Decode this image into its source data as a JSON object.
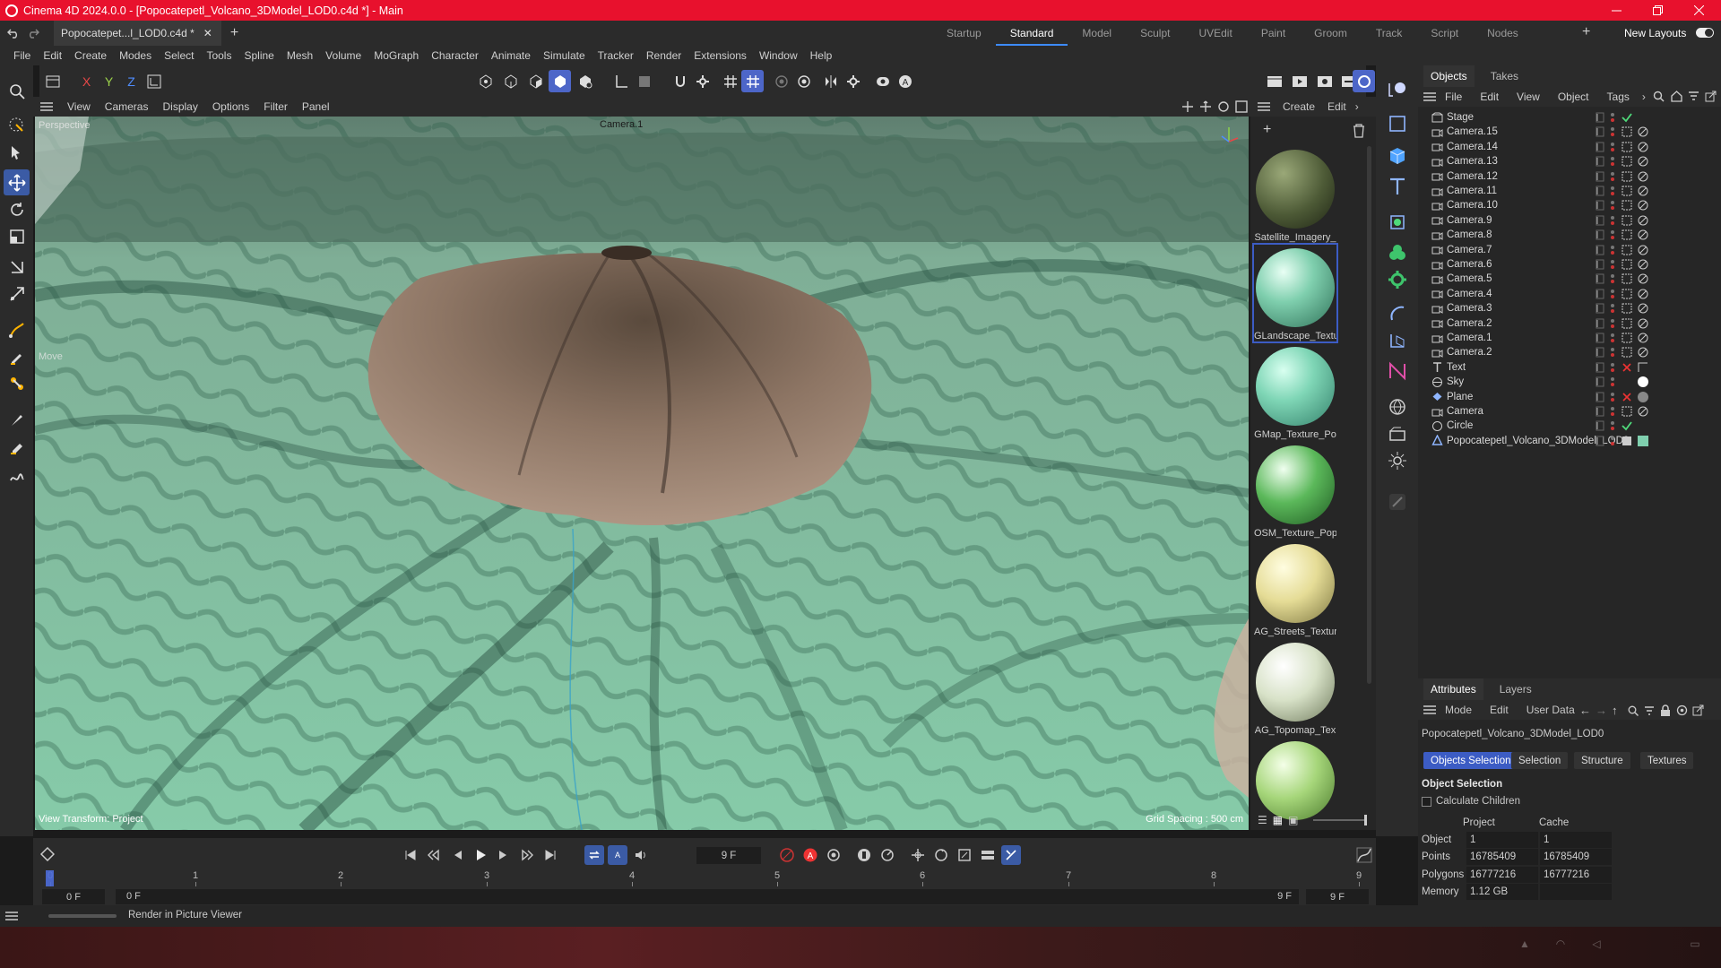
{
  "app": {
    "title": "Cinema 4D 2024.0.0 - [Popocatepetl_Volcano_3DModel_LOD0.c4d *] - Main",
    "doc_tab": "Popocatepet...l_LOD0.c4d *",
    "new_tab_symbol": "+",
    "accent": "#e8112d",
    "selection": "#3c5cc4"
  },
  "layouts": {
    "items": [
      "Startup",
      "Standard",
      "Model",
      "Sculpt",
      "UVEdit",
      "Paint",
      "Groom",
      "Track",
      "Script",
      "Nodes"
    ],
    "active": "Standard",
    "new_layouts": "New Layouts"
  },
  "menu": [
    "File",
    "Edit",
    "Create",
    "Modes",
    "Select",
    "Tools",
    "Spline",
    "Mesh",
    "Volume",
    "MoGraph",
    "Character",
    "Animate",
    "Simulate",
    "Tracker",
    "Render",
    "Extensions",
    "Window",
    "Help"
  ],
  "axes": {
    "x": "X",
    "y": "Y",
    "z": "Z"
  },
  "viewport": {
    "menu": [
      "View",
      "Cameras",
      "Display",
      "Options",
      "Filter",
      "Panel"
    ],
    "label": "Perspective",
    "camera": "Camera.1",
    "move_hint": "Move",
    "view_transform": "View Transform: Project",
    "grid_spacing": "Grid Spacing : 500 cm"
  },
  "materials": {
    "menu": [
      "Create",
      "Edit"
    ],
    "items": [
      {
        "name": "Satellite_Imagery_"
      },
      {
        "name": "GLandscape_Textu"
      },
      {
        "name": "GMap_Texture_Po"
      },
      {
        "name": "OSM_Texture_Pop"
      },
      {
        "name": "AG_Streets_Textur"
      },
      {
        "name": "AG_Topomap_Tex"
      },
      {
        "name": ""
      }
    ]
  },
  "objects": {
    "tabs": [
      "Objects",
      "Takes"
    ],
    "menu": [
      "File",
      "Edit",
      "View",
      "Object",
      "Tags"
    ],
    "items": [
      {
        "name": "Stage",
        "icon": "stage-icon"
      },
      {
        "name": "Camera.15",
        "icon": "camera-icon"
      },
      {
        "name": "Camera.14",
        "icon": "camera-icon"
      },
      {
        "name": "Camera.13",
        "icon": "camera-icon"
      },
      {
        "name": "Camera.12",
        "icon": "camera-icon"
      },
      {
        "name": "Camera.11",
        "icon": "camera-icon"
      },
      {
        "name": "Camera.10",
        "icon": "camera-icon"
      },
      {
        "name": "Camera.9",
        "icon": "camera-icon"
      },
      {
        "name": "Camera.8",
        "icon": "camera-icon"
      },
      {
        "name": "Camera.7",
        "icon": "camera-icon"
      },
      {
        "name": "Camera.6",
        "icon": "camera-icon"
      },
      {
        "name": "Camera.5",
        "icon": "camera-icon"
      },
      {
        "name": "Camera.4",
        "icon": "camera-icon"
      },
      {
        "name": "Camera.3",
        "icon": "camera-icon"
      },
      {
        "name": "Camera.2",
        "icon": "camera-icon"
      },
      {
        "name": "Camera.1",
        "icon": "camera-icon"
      },
      {
        "name": "Camera.2",
        "icon": "camera-icon"
      },
      {
        "name": "Text",
        "icon": "text-icon"
      },
      {
        "name": "Sky",
        "icon": "sky-icon"
      },
      {
        "name": "Plane",
        "icon": "plane-icon"
      },
      {
        "name": "Camera",
        "icon": "camera-icon"
      },
      {
        "name": "Circle",
        "icon": "circle-icon"
      },
      {
        "name": "Popocatepetl_Volcano_3DModel_LOD0",
        "icon": "polygon-object-icon"
      }
    ]
  },
  "attributes": {
    "tabs": [
      "Attributes",
      "Layers"
    ],
    "menu": [
      "Mode",
      "Edit",
      "User Data"
    ],
    "object_name": "Popocatepetl_Volcano_3DModel_LOD0",
    "buttons": [
      "Objects Selection",
      "Selection",
      "Structure",
      "Textures"
    ],
    "active_button": "Objects Selection",
    "section": "Object Selection",
    "calc_children": "Calculate Children",
    "col_project": "Project",
    "col_cache": "Cache",
    "rows": [
      {
        "label": "Object",
        "project": "1",
        "cache": "1"
      },
      {
        "label": "Points",
        "project": "16785409",
        "cache": "16785409"
      },
      {
        "label": "Polygons",
        "project": "16777216",
        "cache": "16777216"
      },
      {
        "label": "Memory",
        "project": "1.12 GB",
        "cache": ""
      }
    ]
  },
  "timeline": {
    "current_frame": "9 F",
    "start_field": "0 F",
    "start_field2": "0 F",
    "end_field": "9 F",
    "end_field2": "9 F",
    "ticks": [
      "0",
      "1",
      "2",
      "3",
      "4",
      "5",
      "6",
      "7",
      "8",
      "9"
    ],
    "playhead_frame": 0,
    "frame_max": 9
  },
  "status": {
    "text": "Render in Picture Viewer"
  }
}
